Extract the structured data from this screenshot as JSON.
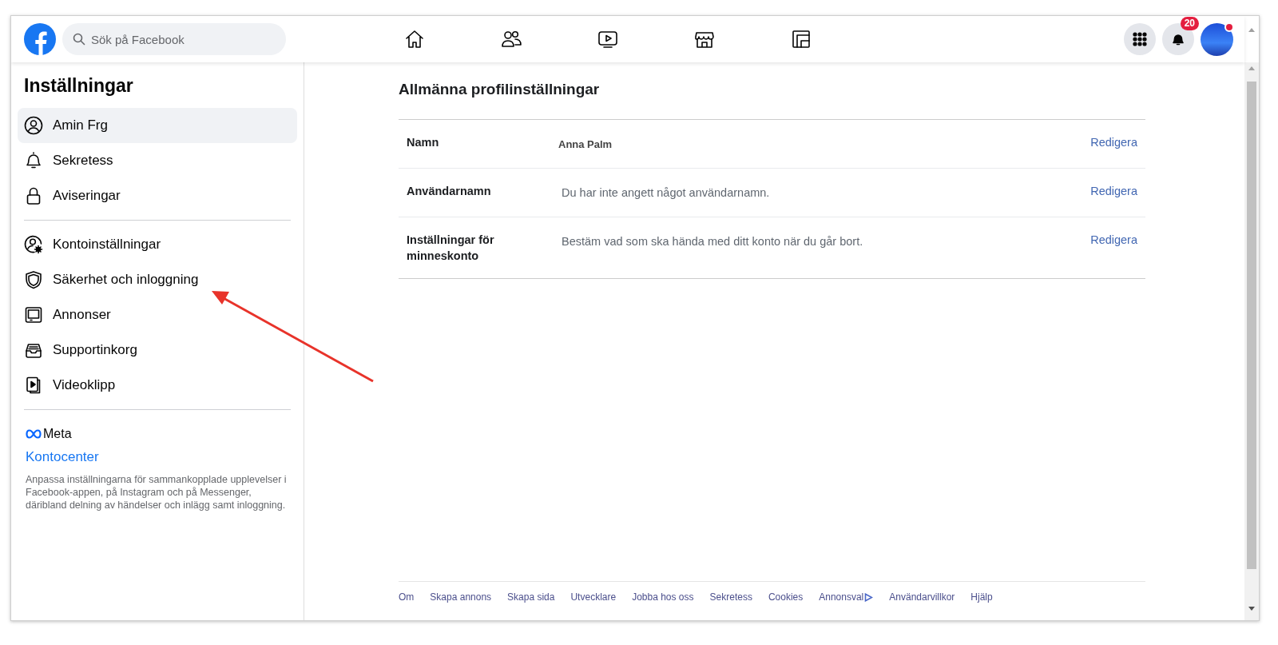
{
  "header": {
    "search": {
      "placeholder": "Sök på Facebook"
    },
    "notifications_badge": "20",
    "avatar": {
      "unread_dot": true
    }
  },
  "sidebar": {
    "title": "Inställningar",
    "groups": [
      {
        "items": [
          {
            "label": "Amin Frg",
            "selected": true
          },
          {
            "label": "Sekretess",
            "selected": false
          },
          {
            "label": "Aviseringar",
            "selected": false
          }
        ]
      },
      {
        "items": [
          {
            "label": "Kontoinställningar",
            "selected": false
          },
          {
            "label": "Säkerhet och inloggning",
            "selected": false
          },
          {
            "label": "Annonser",
            "selected": false
          },
          {
            "label": "Supportinkorg",
            "selected": false
          },
          {
            "label": "Videoklipp",
            "selected": false
          }
        ]
      }
    ],
    "meta": {
      "brand": "Meta",
      "link": "Kontocenter",
      "description": "Anpassa inställningarna för sammankopplade upplevelser i Facebook-appen, på Instagram och på Messenger, däribland delning av händelser och inlägg samt inloggning."
    }
  },
  "main": {
    "title": "Allmänna profilinställningar",
    "rows": [
      {
        "label": "Namn",
        "value": "Anna Palm",
        "kind": "value",
        "action": "Redigera"
      },
      {
        "label": "Användarnamn",
        "value": "Du har inte angett något användarnamn.",
        "kind": "hint",
        "action": "Redigera"
      },
      {
        "label": "Inställningar för minneskonto",
        "value": "Bestäm vad som ska hända med ditt konto när du går bort.",
        "kind": "hint",
        "action": "Redigera"
      }
    ]
  },
  "footer": {
    "links": [
      {
        "label": "Om",
        "kind": "link"
      },
      {
        "label": "Skapa annons",
        "kind": "link"
      },
      {
        "label": "Skapa sida",
        "kind": "link"
      },
      {
        "label": "Utvecklare",
        "kind": "link"
      },
      {
        "label": "Jobba hos oss",
        "kind": "link"
      },
      {
        "label": "Sekretess",
        "kind": "link"
      },
      {
        "label": "Cookies",
        "kind": "link"
      },
      {
        "label": "Annonsval",
        "kind": "adchoices"
      },
      {
        "label": "Användarvillkor",
        "kind": "link"
      },
      {
        "label": "Hjälp",
        "kind": "link"
      }
    ]
  }
}
